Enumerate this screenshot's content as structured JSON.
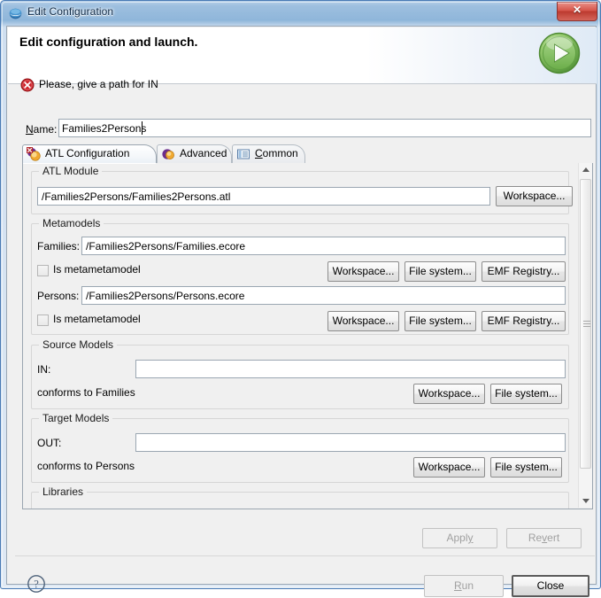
{
  "window": {
    "title": "Edit Configuration",
    "title_icon": "eclipse-globe-icon",
    "close_label": "Close window"
  },
  "header": {
    "title": "Edit configuration and launch.",
    "message": "Please, give a path for IN",
    "message_icon": "error-icon",
    "run_icon": "run-green-arrow-icon"
  },
  "name_row": {
    "label": "Name:",
    "label_mnemonic": "N",
    "value": "Families2Persons",
    "placeholder": ""
  },
  "tabs": [
    {
      "label": "ATL Configuration",
      "icon": "atl-configuration-icon",
      "active": true
    },
    {
      "label": "Advanced",
      "icon": "advanced-icon",
      "active": false
    },
    {
      "label": "Common",
      "icon": "common-icon",
      "active": false
    }
  ],
  "groups": {
    "atl_module": {
      "title": "ATL Module",
      "path": "/Families2Persons/Families2Persons.atl",
      "workspace_button": "Workspace..."
    },
    "metamodels": {
      "title": "Metamodels",
      "rows": [
        {
          "label": "Families:",
          "path": "/Families2Persons/Families.ecore",
          "checkbox_label": "Is metametamodel",
          "checked": false,
          "buttons": [
            "Workspace...",
            "File system...",
            "EMF Registry..."
          ]
        },
        {
          "label": "Persons:",
          "path": "/Families2Persons/Persons.ecore",
          "checkbox_label": "Is metametamodel",
          "checked": false,
          "buttons": [
            "Workspace...",
            "File system...",
            "EMF Registry..."
          ]
        }
      ]
    },
    "source_models": {
      "title": "Source Models",
      "label": "IN:",
      "path": "",
      "conforms": "conforms to Families",
      "buttons": [
        "Workspace...",
        "File system..."
      ]
    },
    "target_models": {
      "title": "Target Models",
      "label": "OUT:",
      "path": "",
      "conforms": "conforms to Persons",
      "buttons": [
        "Workspace...",
        "File system..."
      ]
    },
    "libraries": {
      "title": "Libraries"
    }
  },
  "footer": {
    "apply_label": "Apply",
    "apply_mnemonic": "y",
    "revert_label": "Revert",
    "revert_mnemonic": "v",
    "run_label": "Run",
    "run_mnemonic": "R",
    "close_label": "Close",
    "help_icon": "help-question-icon"
  },
  "colors": {
    "accent_blue": "#4a7bb5",
    "error_red": "#cc2229",
    "run_green": "#6aae45",
    "dialog_bg": "#f0f0f0"
  }
}
